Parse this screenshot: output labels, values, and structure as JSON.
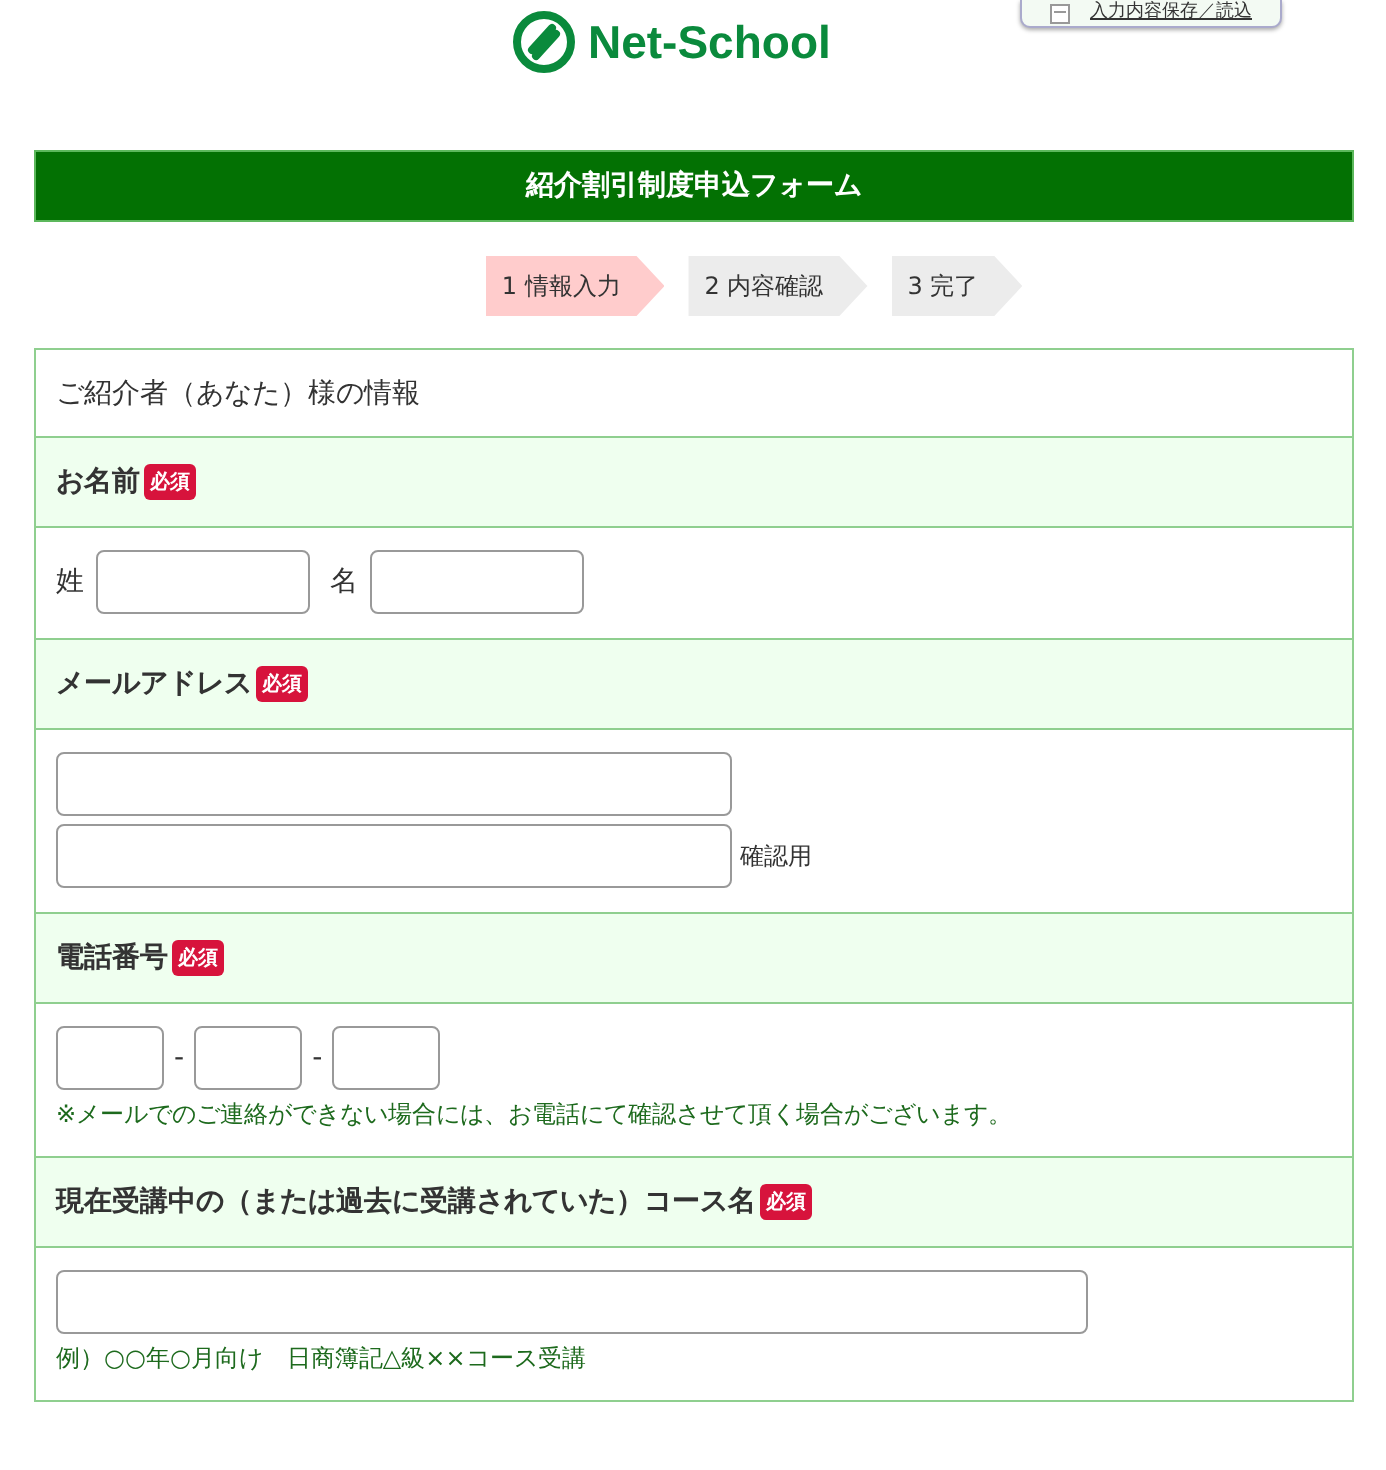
{
  "save_button": {
    "label": "入力内容保存／読込"
  },
  "logo": {
    "text": "Net-School"
  },
  "form_title": "紹介割引制度申込フォーム",
  "steps": [
    {
      "label": "1 情報入力",
      "selected": true
    },
    {
      "label": "2 内容確認",
      "selected": false
    },
    {
      "label": "3 完了",
      "selected": false
    }
  ],
  "section_heading": "ご紹介者（あなた）様の情報",
  "fields": [
    {
      "kind": "name",
      "label": "お名前",
      "required": true,
      "badge": "必須",
      "parts": [
        "姓",
        "名"
      ]
    },
    {
      "kind": "email",
      "label": "メールアドレス",
      "required": true,
      "badge": "必須",
      "confirm_label": "確認用"
    },
    {
      "kind": "phone",
      "label": "電話番号",
      "required": true,
      "badge": "必須",
      "separators": [
        "-",
        "-"
      ],
      "note": "※メールでのご連絡ができない場合には、お電話にて確認させて頂く場合がございます。"
    },
    {
      "kind": "text",
      "label": "現在受講中の（または過去に受講されていた）コース名",
      "required": true,
      "badge": "必須",
      "note": "例）○○年○月向け　日商簿記△級××コース受講"
    }
  ]
}
